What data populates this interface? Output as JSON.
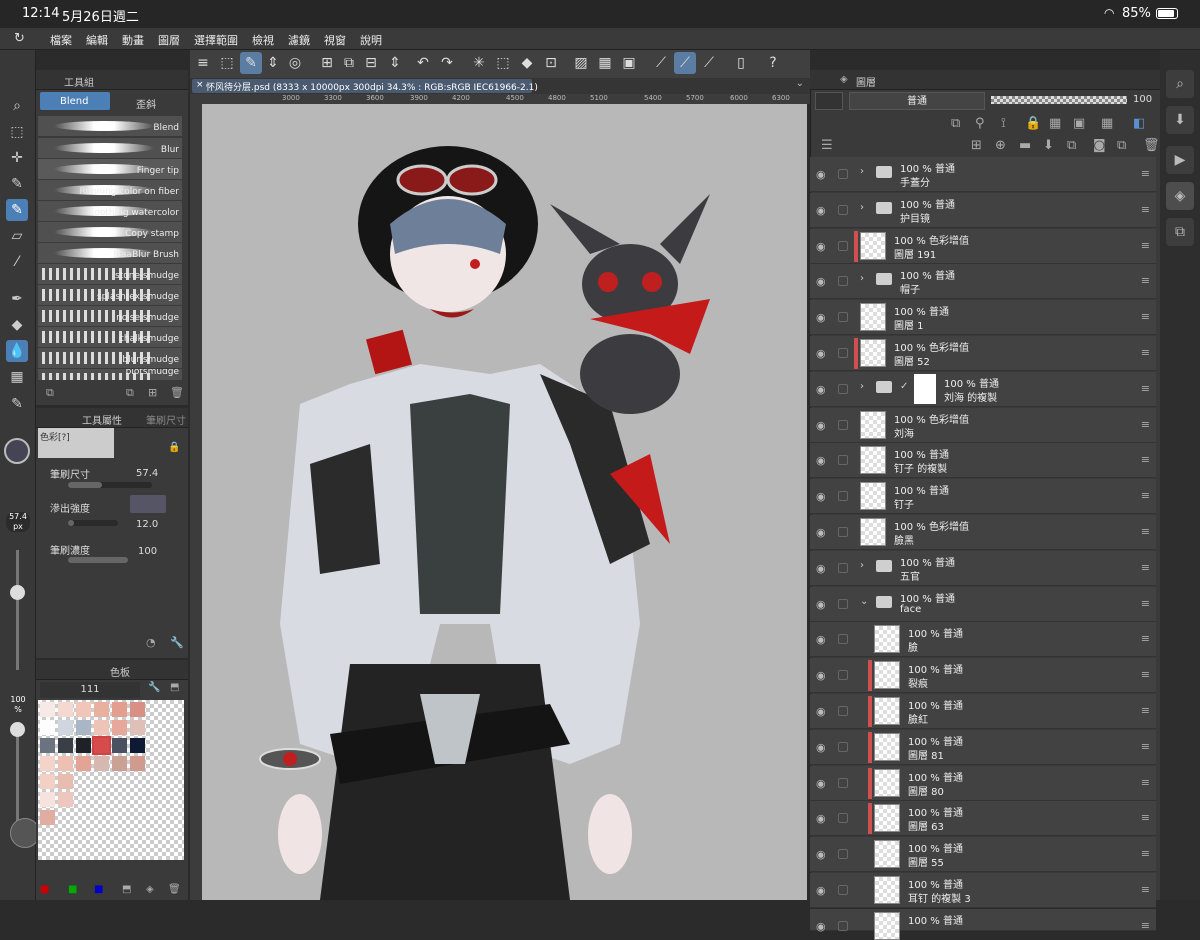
{
  "status_bar": {
    "time": "12:14",
    "date": "5月26日週二",
    "battery": "85%"
  },
  "menu": [
    "檔案",
    "編輯",
    "動畫",
    "圖層",
    "選擇範圍",
    "檢視",
    "濾鏡",
    "視窗",
    "說明"
  ],
  "subtool": {
    "header": "工具組",
    "tabs": [
      "Blend",
      "歪斜"
    ],
    "brushes": [
      "Blend",
      "Blur",
      "Finger tip",
      "Running color on fiber",
      "Soothing watercolor",
      "Copy stamp",
      "MaaBlur Brush",
      "stone smudge",
      "splashtex smudge",
      "noise smudge",
      "chalksmudge",
      "blur smudge",
      "blotsmudge"
    ]
  },
  "tool_property": {
    "header": "工具屬性",
    "tab2": "筆刷尺寸",
    "preset_label": "色彩[?]",
    "brush_size_label": "筆刷尺寸",
    "brush_size_value": "57.4",
    "blend_strength_label": "滲出強度",
    "blend_strength_value": "12.0",
    "density_label": "筆刷濃度",
    "density_value": "100",
    "size_indicator": "57.4",
    "size_unit": "px",
    "opacity_indicator": "100",
    "opacity_unit": "%"
  },
  "palette": {
    "header": "色板",
    "set_value": "111"
  },
  "canvas": {
    "tab_title": "怀风待分层.psd (8333 x 10000px 300dpi 34.3% : RGB:sRGB IEC61966-2.1)",
    "ruler": [
      "2800",
      "3000",
      "3300",
      "3600",
      "3900",
      "4200",
      "4500",
      "4800",
      "5100",
      "5400",
      "5700",
      "6000",
      "6300"
    ]
  },
  "layer_panel": {
    "header": "圖層",
    "blend_mode": "普通",
    "opacity": "100",
    "layers": [
      {
        "pct": "100 %",
        "mode": "普通",
        "name": "手蓋分",
        "type": "folder"
      },
      {
        "pct": "100 %",
        "mode": "普通",
        "name": "护目镜",
        "type": "folder"
      },
      {
        "pct": "100 %",
        "mode": "色彩增值",
        "name": "圖層 191",
        "type": "layer",
        "red": true
      },
      {
        "pct": "100 %",
        "mode": "普通",
        "name": "帽子",
        "type": "folder"
      },
      {
        "pct": "100 %",
        "mode": "普通",
        "name": "圖層 1",
        "type": "layer"
      },
      {
        "pct": "100 %",
        "mode": "色彩增值",
        "name": "圖層 52",
        "type": "layer",
        "red": true
      },
      {
        "pct": "100 %",
        "mode": "普通",
        "name": "刘海 的複製",
        "type": "folder-mask"
      },
      {
        "pct": "100 %",
        "mode": "色彩增值",
        "name": "刘海",
        "type": "layer"
      },
      {
        "pct": "100 %",
        "mode": "普通",
        "name": "钉子 的複製",
        "type": "layer"
      },
      {
        "pct": "100 %",
        "mode": "普通",
        "name": "钉子",
        "type": "layer"
      },
      {
        "pct": "100 %",
        "mode": "色彩增值",
        "name": "臉黑",
        "type": "layer"
      },
      {
        "pct": "100 %",
        "mode": "普通",
        "name": "五官",
        "type": "folder"
      },
      {
        "pct": "100 %",
        "mode": "普通",
        "name": "face",
        "type": "folder-open"
      },
      {
        "pct": "100 %",
        "mode": "普通",
        "name": "臉",
        "type": "child"
      },
      {
        "pct": "100 %",
        "mode": "普通",
        "name": "裂痕",
        "type": "child",
        "red": true
      },
      {
        "pct": "100 %",
        "mode": "普通",
        "name": "臉紅",
        "type": "child",
        "red": true
      },
      {
        "pct": "100 %",
        "mode": "普通",
        "name": "圖層 81",
        "type": "child",
        "red": true
      },
      {
        "pct": "100 %",
        "mode": "普通",
        "name": "圖層 80",
        "type": "child",
        "red": true
      },
      {
        "pct": "100 %",
        "mode": "普通",
        "name": "圖層 63",
        "type": "child",
        "red": true
      },
      {
        "pct": "100 %",
        "mode": "普通",
        "name": "圖層 55",
        "type": "child"
      },
      {
        "pct": "100 %",
        "mode": "普通",
        "name": "耳钉 的複製 3",
        "type": "child"
      },
      {
        "pct": "100 %",
        "mode": "普通",
        "name": "",
        "type": "child"
      }
    ]
  },
  "colors": {
    "accent": "#4c7fb5",
    "layer_red": "#d05050",
    "canvas_bg": "#b8b8b8"
  }
}
